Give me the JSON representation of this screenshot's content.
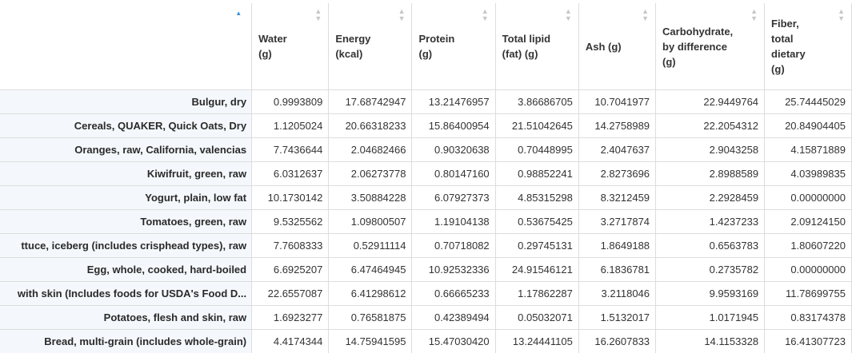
{
  "table": {
    "columns": [
      {
        "label": ""
      },
      {
        "label": "Water\n(g)"
      },
      {
        "label": "Energy\n(kcal)"
      },
      {
        "label": "Protein\n(g)"
      },
      {
        "label": "Total lipid\n(fat) (g)"
      },
      {
        "label": "Ash (g)"
      },
      {
        "label": "Carbohydrate,\nby difference\n(g)"
      },
      {
        "label": "Fiber,\ntotal\ndietary\n(g)"
      }
    ],
    "rows": [
      {
        "name": "Bulgur, dry",
        "values": [
          "0.9993809",
          "17.68742947",
          "13.21476957",
          "3.86686705",
          "10.7041977",
          "22.9449764",
          "25.74445029"
        ]
      },
      {
        "name": "Cereals, QUAKER, Quick Oats, Dry",
        "values": [
          "1.1205024",
          "20.66318233",
          "15.86400954",
          "21.51042645",
          "14.2758989",
          "22.2054312",
          "20.84904405"
        ]
      },
      {
        "name": "Oranges, raw, California, valencias",
        "values": [
          "7.7436644",
          "2.04682466",
          "0.90320638",
          "0.70448995",
          "2.4047637",
          "2.9043258",
          "4.15871889"
        ]
      },
      {
        "name": "Kiwifruit, green, raw",
        "values": [
          "6.0312637",
          "2.06273778",
          "0.80147160",
          "0.98852241",
          "2.8273696",
          "2.8988589",
          "4.03989835"
        ]
      },
      {
        "name": "Yogurt, plain, low fat",
        "values": [
          "10.1730142",
          "3.50884228",
          "6.07927373",
          "4.85315298",
          "8.3212459",
          "2.2928459",
          "0.00000000"
        ]
      },
      {
        "name": "Tomatoes, green, raw",
        "values": [
          "9.5325562",
          "1.09800507",
          "1.19104138",
          "0.53675425",
          "3.2717874",
          "1.4237233",
          "2.09124150"
        ]
      },
      {
        "name": "ttuce, iceberg (includes crisphead types), raw",
        "values": [
          "7.7608333",
          "0.52911114",
          "0.70718082",
          "0.29745131",
          "1.8649188",
          "0.6563783",
          "1.80607220"
        ]
      },
      {
        "name": "Egg, whole, cooked, hard-boiled",
        "values": [
          "6.6925207",
          "6.47464945",
          "10.92532336",
          "24.91546121",
          "6.1836781",
          "0.2735782",
          "0.00000000"
        ]
      },
      {
        "name": "with skin (Includes foods for USDA's Food D...",
        "values": [
          "22.6557087",
          "6.41298612",
          "0.66665233",
          "1.17862287",
          "3.2118046",
          "9.9593169",
          "11.78699755"
        ]
      },
      {
        "name": "Potatoes, flesh and skin, raw",
        "values": [
          "1.6923277",
          "0.76581875",
          "0.42389494",
          "0.05032071",
          "1.5132017",
          "1.0171945",
          "0.83174378"
        ]
      },
      {
        "name": "Bread, multi-grain (includes whole-grain)",
        "values": [
          "4.4174344",
          "14.75941595",
          "15.47030420",
          "13.24441105",
          "16.2607833",
          "14.1153328",
          "16.41307723"
        ]
      }
    ]
  }
}
